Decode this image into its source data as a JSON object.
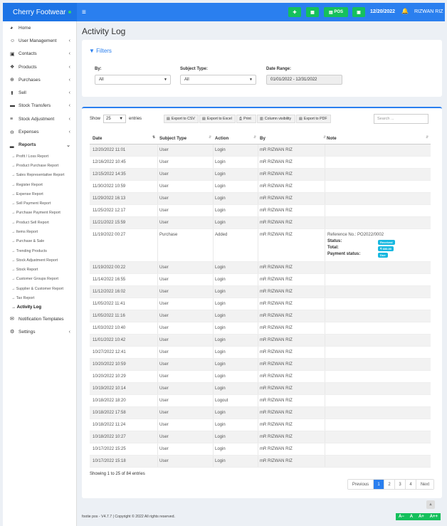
{
  "brand": {
    "name": "Cherry Footwear",
    "status_color": "#33d36a"
  },
  "header": {
    "menu_icon": "hamburger-icon",
    "pos_label": "POS",
    "date": "12/20/2022",
    "user": "RIZWAN RIZ",
    "accent": "#2a7fef",
    "button_color": "#15c05c"
  },
  "sidebar": {
    "items": [
      {
        "label": "Home",
        "icon": "dashboard-icon",
        "chevron": false
      },
      {
        "label": "User Management",
        "icon": "users-icon",
        "chevron": true
      },
      {
        "label": "Contacts",
        "icon": "address-book-icon",
        "chevron": true
      },
      {
        "label": "Products",
        "icon": "cubes-icon",
        "chevron": true
      },
      {
        "label": "Purchases",
        "icon": "plus-circle-icon",
        "chevron": true
      },
      {
        "label": "Sell",
        "icon": "arrow-circle-up-icon",
        "chevron": true
      },
      {
        "label": "Stock Transfers",
        "icon": "truck-icon",
        "chevron": true
      },
      {
        "label": "Stock Adjustment",
        "icon": "database-icon",
        "chevron": true
      },
      {
        "label": "Expenses",
        "icon": "minus-circle-icon",
        "chevron": true
      },
      {
        "label": "Reports",
        "icon": "bar-chart-icon",
        "chevron": true,
        "active": true
      }
    ],
    "reports": [
      "Profit / Loss Report",
      "Product Purchase Report",
      "Sales Representative Report",
      "Register Report",
      "Expense Report",
      "Sell Payment Report",
      "Purchase Payment Report",
      "Product Sell Report",
      "Items Report",
      "Purchase & Sale",
      "Trending Products",
      "Stock Adjustment Report",
      "Stock Report",
      "Customer Groups Report",
      "Supplier & Customer Report",
      "Tax Report",
      "Activity Log"
    ],
    "after": [
      {
        "label": "Notification Templates",
        "icon": "envelope-icon",
        "chevron": false
      },
      {
        "label": "Settings",
        "icon": "gear-icon",
        "chevron": true
      }
    ]
  },
  "page": {
    "title": "Activity Log"
  },
  "filters": {
    "heading": "Filters",
    "by_label": "By:",
    "by_value": "All",
    "subject_label": "Subject Type:",
    "subject_value": "All",
    "range_label": "Date Range:",
    "range_value": "01/01/2022 - 12/31/2022"
  },
  "table": {
    "show_label": "Show",
    "entries_label": "entries",
    "length": "25",
    "buttons": [
      "Export to CSV",
      "Export to Excel",
      "Print",
      "Column visibility",
      "Export to PDF"
    ],
    "search_placeholder": "Search ...",
    "columns": [
      "Date",
      "Subject Type",
      "Action",
      "By",
      "Note"
    ],
    "rows": [
      [
        "12/20/2022 11:01",
        "User",
        "Login",
        "mR RIZWAN RIZ"
      ],
      [
        "12/16/2022 10:45",
        "User",
        "Login",
        "mR RIZWAN RIZ"
      ],
      [
        "12/15/2022 14:35",
        "User",
        "Login",
        "mR RIZWAN RIZ"
      ],
      [
        "11/30/2022 10:59",
        "User",
        "Login",
        "mR RIZWAN RIZ"
      ],
      [
        "11/29/2022 16:13",
        "User",
        "Login",
        "mR RIZWAN RIZ"
      ],
      [
        "11/25/2022 12:17",
        "User",
        "Login",
        "mR RIZWAN RIZ"
      ],
      [
        "11/21/2022 15:59",
        "User",
        "Login",
        "mR RIZWAN RIZ"
      ],
      [
        "11/19/2022 00:27",
        "Purchase",
        "Added",
        "mR RIZWAN RIZ"
      ],
      [
        "11/19/2022 00:22",
        "User",
        "Login",
        "mR RIZWAN RIZ"
      ],
      [
        "11/14/2022 16:55",
        "User",
        "Login",
        "mR RIZWAN RIZ"
      ],
      [
        "11/12/2022 16:02",
        "User",
        "Login",
        "mR RIZWAN RIZ"
      ],
      [
        "11/05/2022 11:41",
        "User",
        "Login",
        "mR RIZWAN RIZ"
      ],
      [
        "11/05/2022 11:16",
        "User",
        "Login",
        "mR RIZWAN RIZ"
      ],
      [
        "11/03/2022 10:40",
        "User",
        "Login",
        "mR RIZWAN RIZ"
      ],
      [
        "11/01/2022 10:42",
        "User",
        "Login",
        "mR RIZWAN RIZ"
      ],
      [
        "10/27/2022 12:41",
        "User",
        "Login",
        "mR RIZWAN RIZ"
      ],
      [
        "10/20/2022 10:59",
        "User",
        "Login",
        "mR RIZWAN RIZ"
      ],
      [
        "10/20/2022 10:29",
        "User",
        "Login",
        "mR RIZWAN RIZ"
      ],
      [
        "10/19/2022 10:14",
        "User",
        "Login",
        "mR RIZWAN RIZ"
      ],
      [
        "10/18/2022 18:20",
        "User",
        "Logout",
        "mR RIZWAN RIZ"
      ],
      [
        "10/18/2022 17:58",
        "User",
        "Login",
        "mR RIZWAN RIZ"
      ],
      [
        "10/18/2022 11:24",
        "User",
        "Login",
        "mR RIZWAN RIZ"
      ],
      [
        "10/18/2022 10:27",
        "User",
        "Login",
        "mR RIZWAN RIZ"
      ],
      [
        "10/17/2022 15:25",
        "User",
        "Login",
        "mR RIZWAN RIZ"
      ],
      [
        "10/17/2022 15:18",
        "User",
        "Login",
        "mR RIZWAN RIZ"
      ]
    ],
    "purchase_note": {
      "ref": "Reference No.: PO2022/0002",
      "status_label": "Status:",
      "status_value": "Received",
      "total_label": "Total:",
      "total_value": "₹ 600.00",
      "payment_label": "Payment status:",
      "payment_value": "Due"
    },
    "info": "Showing 1 to 25 of 84 entries",
    "pagination": [
      "Previous",
      "1",
      "2",
      "3",
      "4",
      "Next"
    ]
  },
  "footer": {
    "text": "footie pos - V4.7.7 | Copyright © 2022 All rights reserved.",
    "font_controls": [
      "A−",
      "A",
      "A+",
      "A++"
    ]
  }
}
